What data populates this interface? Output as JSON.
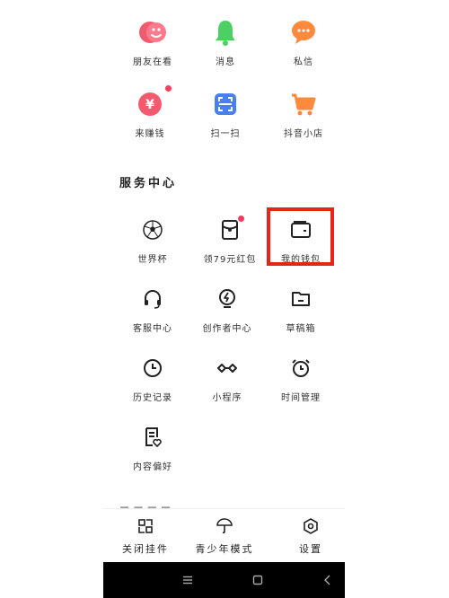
{
  "top_grid": [
    {
      "label": "朋友在看",
      "icon": "friends-watching-icon",
      "color": "#f25a6e"
    },
    {
      "label": "消息",
      "icon": "bell-icon",
      "color": "#4cd064"
    },
    {
      "label": "私信",
      "icon": "chat-bubble-icon",
      "color": "#ff8a3d"
    },
    {
      "label": "来赚钱",
      "icon": "yuan-coin-icon",
      "color": "#f25a6e",
      "badge": true
    },
    {
      "label": "扫一扫",
      "icon": "scan-icon",
      "color": "#4a7ff0"
    },
    {
      "label": "抖音小店",
      "icon": "cart-icon",
      "color": "#ff8a3d"
    }
  ],
  "service_section": {
    "title": "服务中心",
    "items": [
      {
        "label": "世界杯",
        "icon": "soccer-ball-icon"
      },
      {
        "label": "领79元红包",
        "icon": "red-packet-icon",
        "badge": true
      },
      {
        "label": "我的钱包",
        "icon": "wallet-icon",
        "highlighted": true
      },
      {
        "label": "客服中心",
        "icon": "headset-icon"
      },
      {
        "label": "创作者中心",
        "icon": "lightning-icon"
      },
      {
        "label": "草稿箱",
        "icon": "folder-icon"
      },
      {
        "label": "历史记录",
        "icon": "clock-icon"
      },
      {
        "label": "小程序",
        "icon": "infinity-icon"
      },
      {
        "label": "时间管理",
        "icon": "alarm-icon"
      },
      {
        "label": "内容偏好",
        "icon": "doc-heart-icon"
      }
    ]
  },
  "bottom_bar": [
    {
      "label": "关闭挂件",
      "icon": "widget-icon"
    },
    {
      "label": "青少年模式",
      "icon": "umbrella-icon"
    },
    {
      "label": "设置",
      "icon": "settings-hex-icon"
    }
  ],
  "nav_bar": [
    "menu-icon",
    "home-square-icon",
    "back-chevron-icon"
  ],
  "colors": {
    "highlight": "#e8231a",
    "badge": "#ff3b5c"
  }
}
